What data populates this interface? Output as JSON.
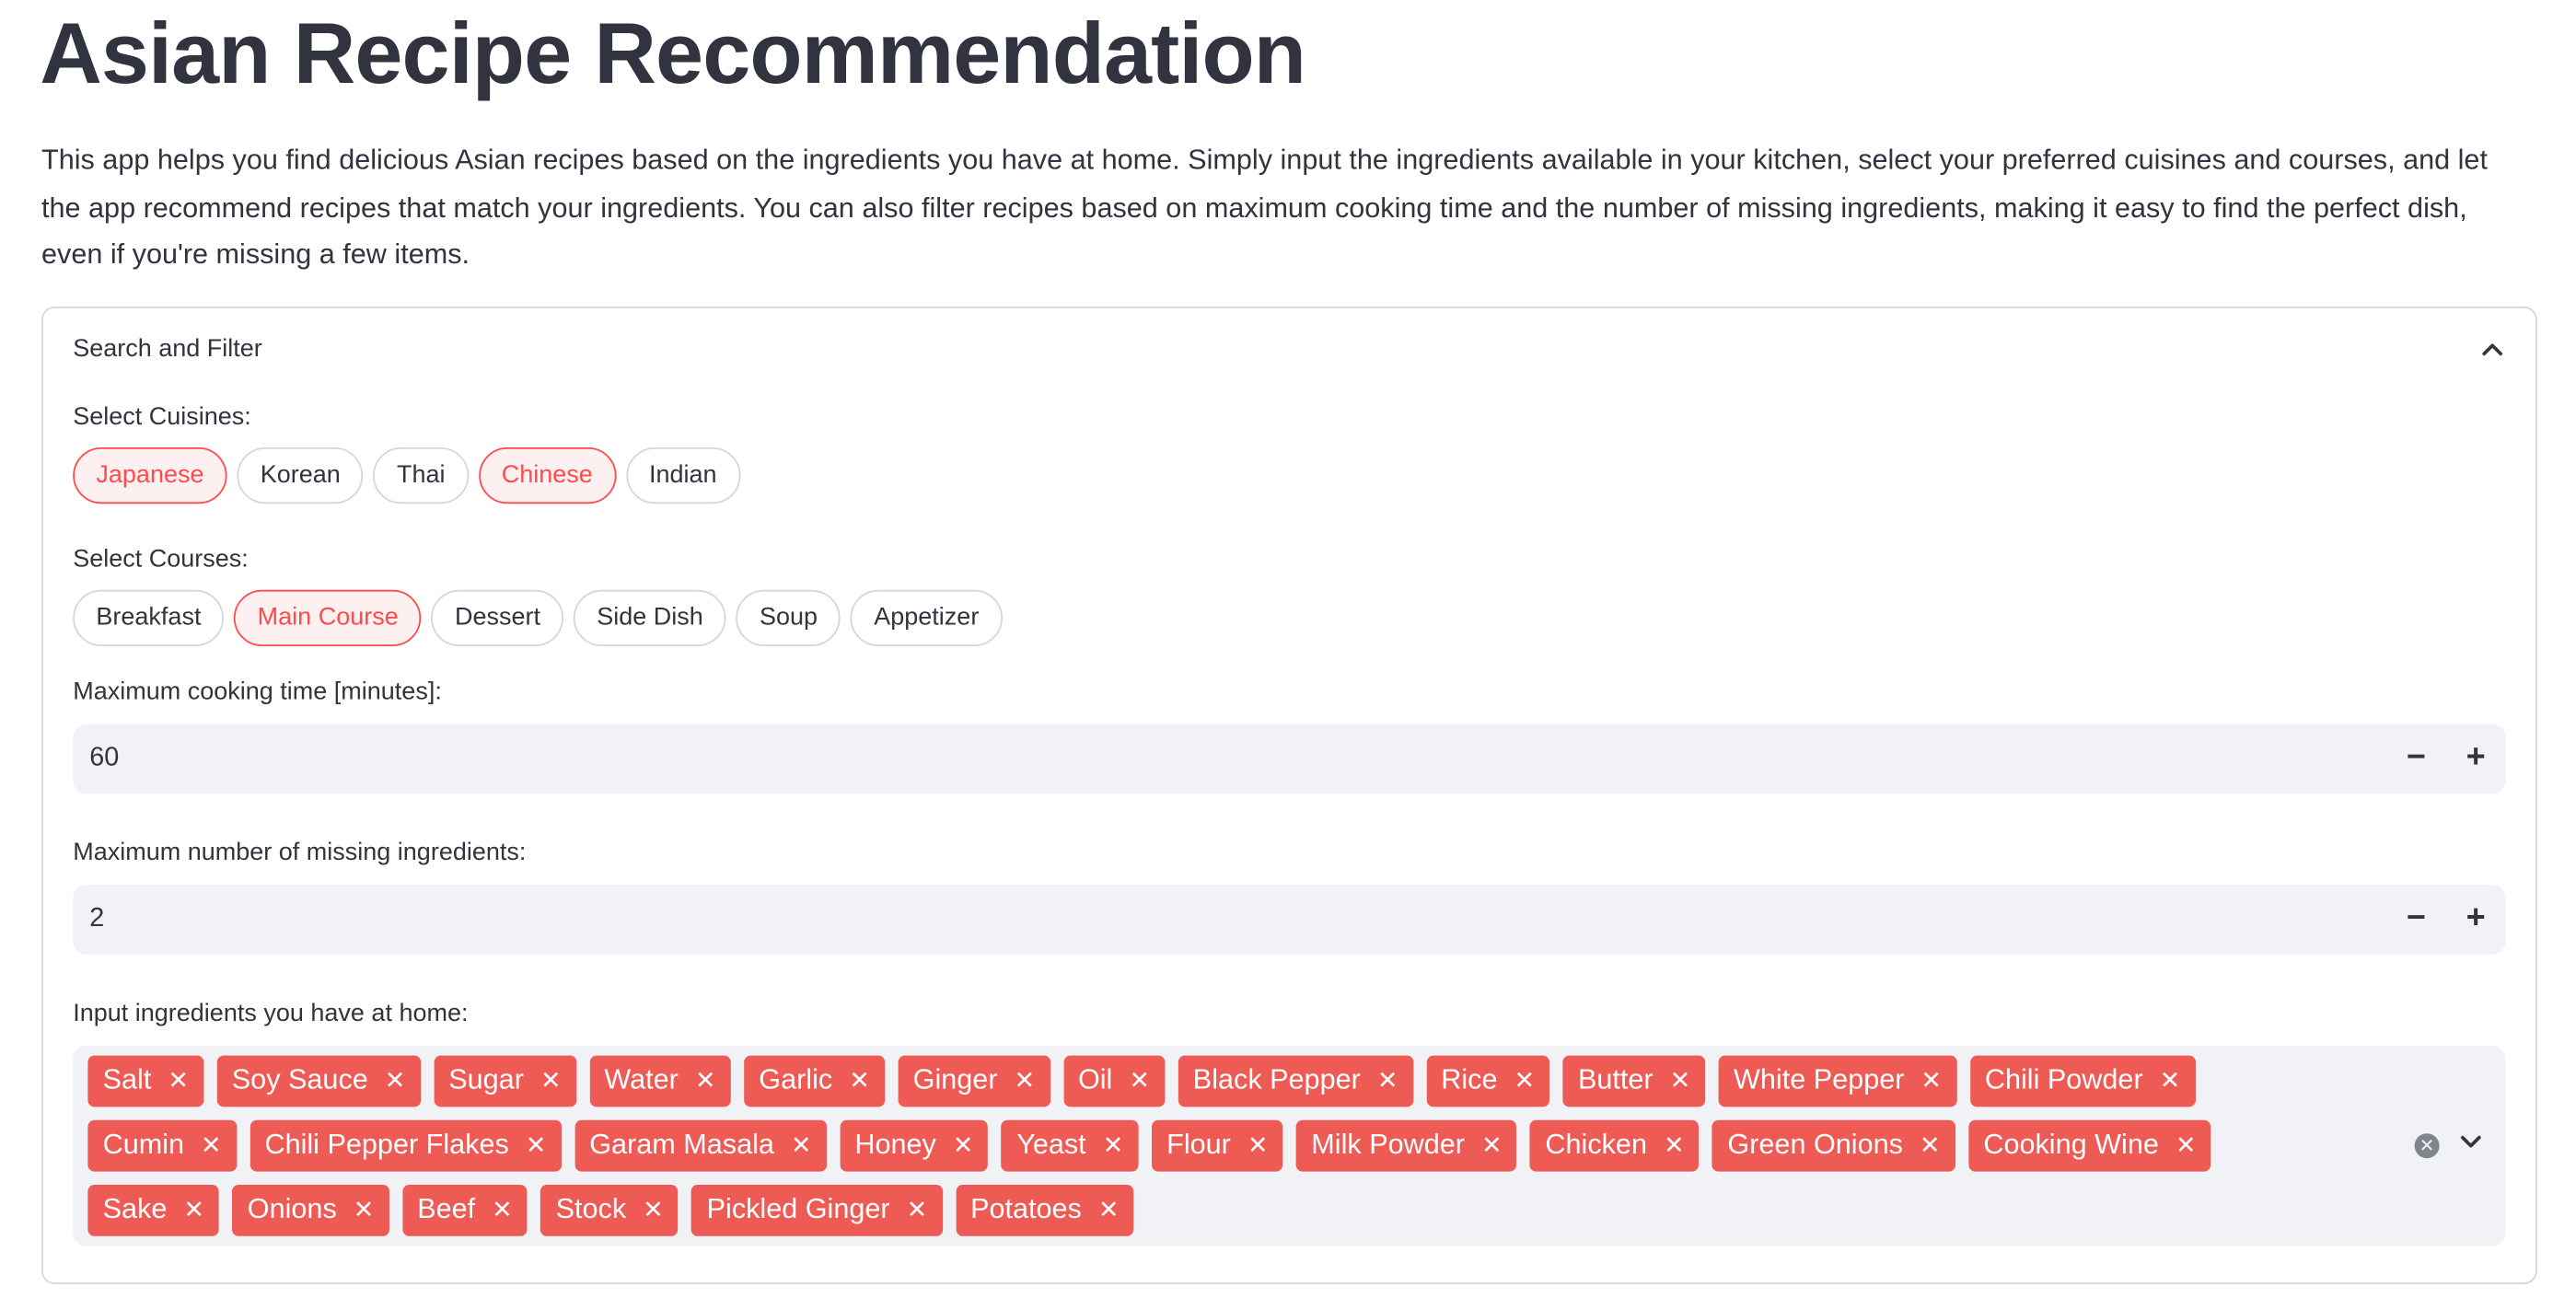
{
  "app": {
    "title": "Asian Recipe Recommendation",
    "description": "This app helps you find delicious Asian recipes based on the ingredients you have at home. Simply input the ingredients available in your kitchen, select your preferred cuisines and courses, and let the app recommend recipes that match your ingredients. You can also filter recipes based on maximum cooking time and the number of missing ingredients, making it easy to find the perfect dish, even if you're missing a few items."
  },
  "expander": {
    "label": "Search and Filter",
    "expanded": true
  },
  "cuisines": {
    "label": "Select Cuisines:",
    "options": [
      {
        "label": "Japanese",
        "selected": true
      },
      {
        "label": "Korean",
        "selected": false
      },
      {
        "label": "Thai",
        "selected": false
      },
      {
        "label": "Chinese",
        "selected": true
      },
      {
        "label": "Indian",
        "selected": false
      }
    ]
  },
  "courses": {
    "label": "Select Courses:",
    "options": [
      {
        "label": "Breakfast",
        "selected": false
      },
      {
        "label": "Main Course",
        "selected": true
      },
      {
        "label": "Dessert",
        "selected": false
      },
      {
        "label": "Side Dish",
        "selected": false
      },
      {
        "label": "Soup",
        "selected": false
      },
      {
        "label": "Appetizer",
        "selected": false
      }
    ]
  },
  "cooking_time": {
    "label": "Maximum cooking time [minutes]:",
    "value": "60",
    "minus": "−",
    "plus": "+"
  },
  "missing_ingredients": {
    "label": "Maximum number of missing ingredients:",
    "value": "2",
    "minus": "−",
    "plus": "+"
  },
  "ingredients": {
    "label": "Input ingredients you have at home:",
    "remove_glyph": "✕",
    "items": [
      "Salt",
      "Soy Sauce",
      "Sugar",
      "Water",
      "Garlic",
      "Ginger",
      "Oil",
      "Black Pepper",
      "Rice",
      "Butter",
      "White Pepper",
      "Chili Powder",
      "Cumin",
      "Chili Pepper Flakes",
      "Garam Masala",
      "Honey",
      "Yeast",
      "Flour",
      "Milk Powder",
      "Chicken",
      "Green Onions",
      "Cooking Wine",
      "Sake",
      "Onions",
      "Beef",
      "Stock",
      "Pickled Ginger",
      "Potatoes"
    ]
  },
  "colors": {
    "accent": "#ff4b4b",
    "tag_bg": "#ee5a54",
    "input_bg": "#f0f2f6",
    "text": "#31333f"
  }
}
